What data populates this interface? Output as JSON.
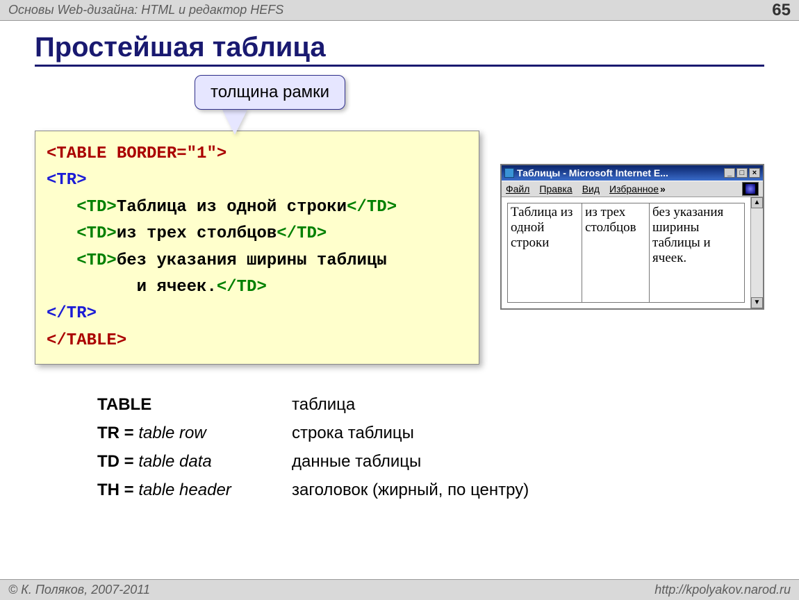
{
  "topbar": {
    "left": "Основы Web-дизайна: HTML и редактор HEFS",
    "page_number": "65"
  },
  "title": "Простейшая таблица",
  "callout": "толщина рамки",
  "code": {
    "open_table": "<TABLE BORDER=\"1\">",
    "open_tr": "<TR>",
    "td_open1": "<TD>",
    "cell1": "Таблица из одной строки",
    "td_close1": "</TD>",
    "td_open2": "<TD>",
    "cell2": "из трех столбцов",
    "td_close2": "</TD>",
    "td_open3": "<TD>",
    "cell3a": "без указания ширины таблицы",
    "cell3b": "и ячеек.",
    "td_close3": "</TD>",
    "close_tr": "</TR>",
    "close_table": "</TABLE>"
  },
  "ie_window": {
    "title": "Таблицы - Microsoft Internet E...",
    "menu": {
      "file": "Файл",
      "edit": "Правка",
      "view": "Вид",
      "fav": "Избранное"
    },
    "cells": [
      "Таблица из одной строки",
      "из трех столбцов",
      "без указания ширины таблицы и ячеек."
    ],
    "min_btn": "_",
    "max_btn": "□",
    "close_btn": "×",
    "scroll_up": "▲",
    "scroll_down": "▼"
  },
  "glossary": [
    {
      "term_bold": "TABLE",
      "term_rest": "",
      "def": "таблица"
    },
    {
      "term_bold": "TR = ",
      "term_rest": "table row",
      "def": "строка таблицы"
    },
    {
      "term_bold": "TD = ",
      "term_rest": "table data",
      "def": "данные таблицы"
    },
    {
      "term_bold": "TH = ",
      "term_rest": "table header",
      "def": "заголовок (жирный, по центру)"
    }
  ],
  "footer": {
    "left": "© К. Поляков, 2007-2011",
    "right": "http://kpolyakov.narod.ru"
  }
}
